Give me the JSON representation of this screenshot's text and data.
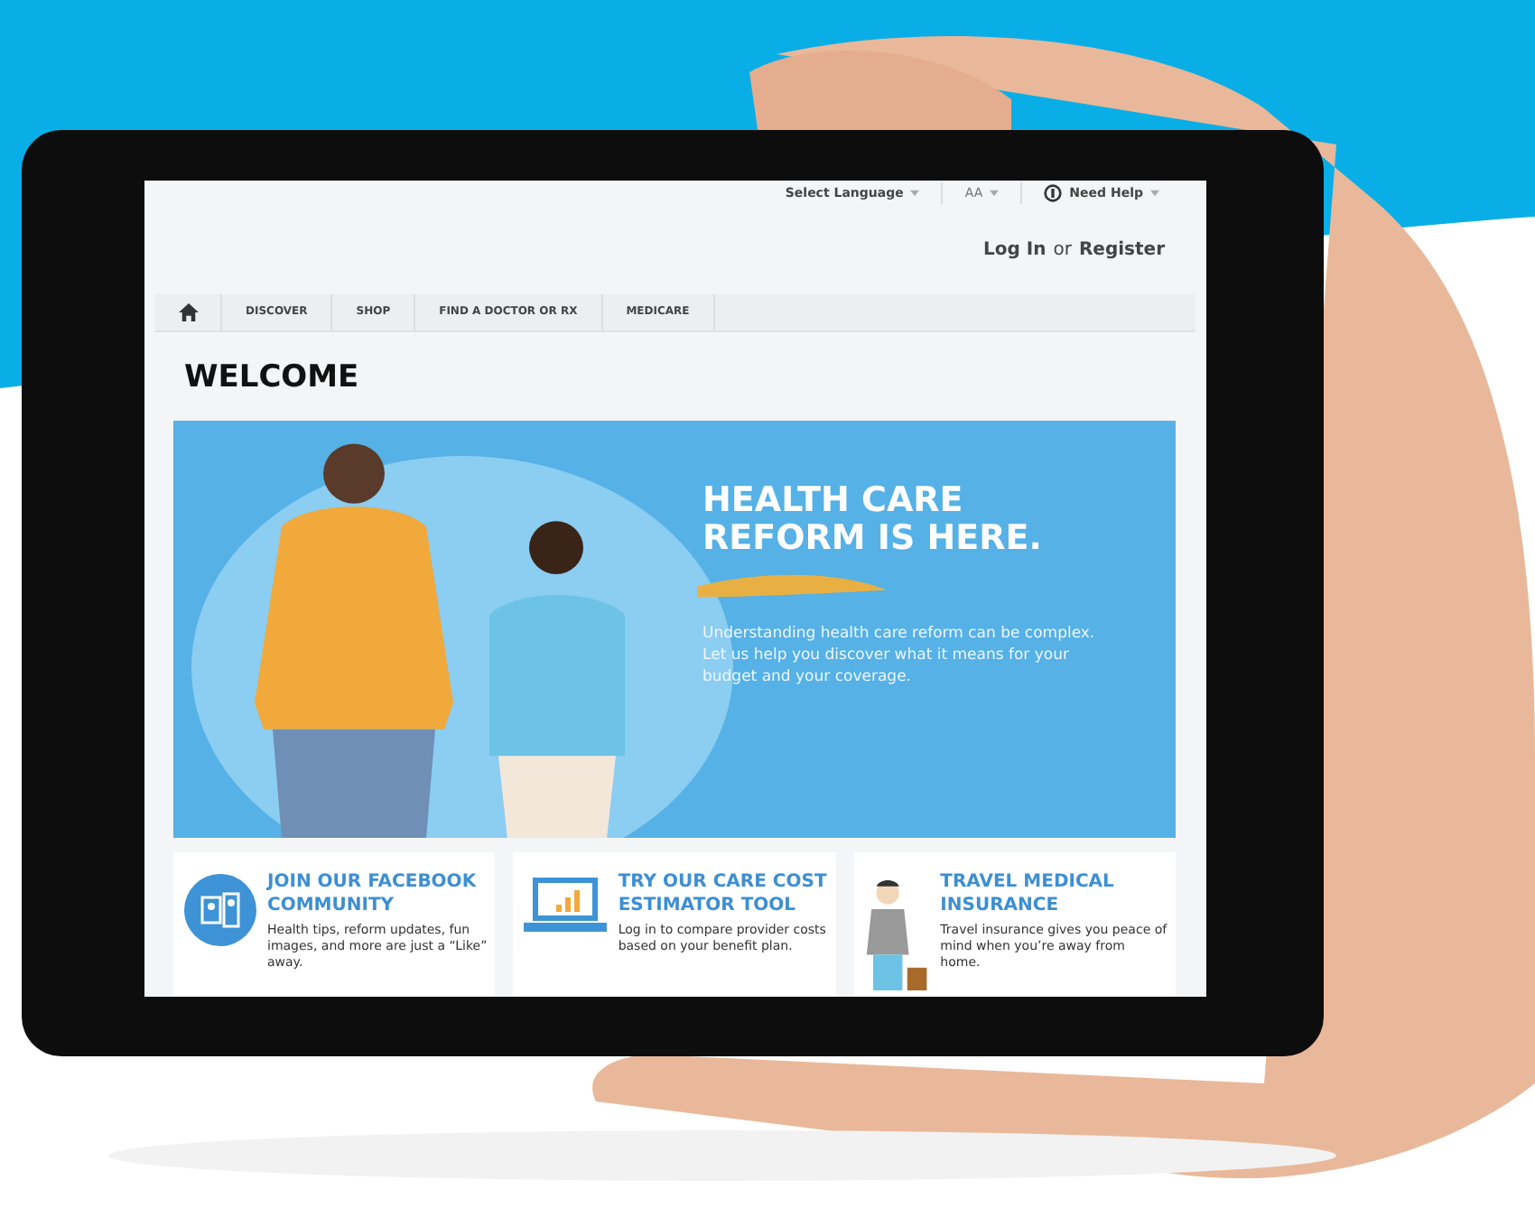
{
  "utility_bar": {
    "language": "Select Language",
    "text_size": "AA",
    "help": "Need Help"
  },
  "account": {
    "login": "Log In",
    "separator": "or",
    "register": "Register"
  },
  "nav": {
    "items": [
      {
        "label": "DISCOVER"
      },
      {
        "label": "SHOP"
      },
      {
        "label": "FIND A DOCTOR OR RX"
      },
      {
        "label": "MEDICARE"
      }
    ]
  },
  "heading": "WELCOME",
  "hero": {
    "title": "HEALTH CARE REFORM IS HERE.",
    "text": "Understanding health care reform can be complex. Let us help you discover what it means for your budget and your coverage."
  },
  "cards": [
    {
      "kind": "community",
      "title": "JOIN OUR FACEBOOK COMMUNITY",
      "text": "Health tips, reform updates, fun images, and more are just a “Like” away."
    },
    {
      "kind": "estimator",
      "title": "TRY OUR CARE COST ESTIMATOR TOOL",
      "text": "Log in to compare provider costs based on your benefit plan."
    },
    {
      "kind": "travel",
      "title": "TRAVEL MEDICAL INSURANCE",
      "text": "Travel insurance gives you peace of mind when you’re away from home."
    }
  ]
}
